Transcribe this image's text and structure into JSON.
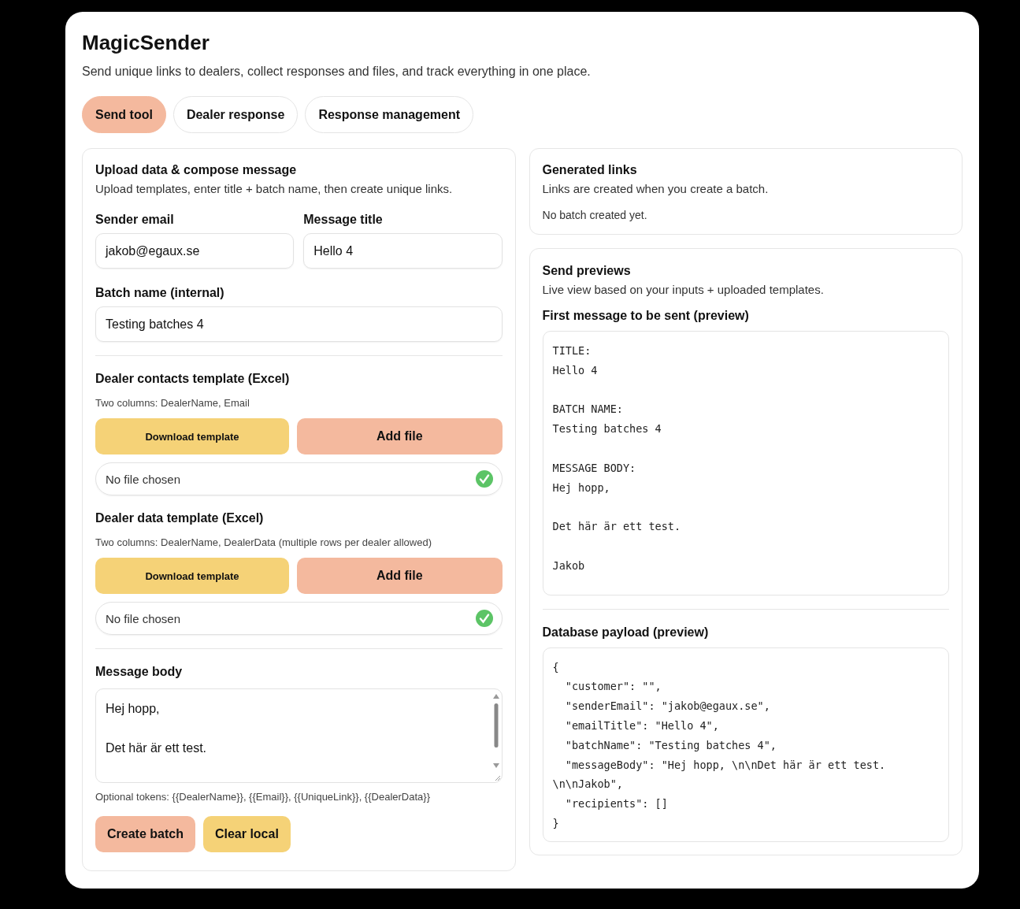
{
  "app": {
    "title": "MagicSender",
    "subtitle": "Send unique links to dealers, collect responses and files, and track everything in one place."
  },
  "tabs": [
    {
      "label": "Send tool",
      "selected": true
    },
    {
      "label": "Dealer response",
      "selected": false
    },
    {
      "label": "Response management",
      "selected": false
    }
  ],
  "compose": {
    "title": "Upload data & compose message",
    "subtitle": "Upload templates, enter title + batch name, then create unique links.",
    "sender_email": {
      "label": "Sender email",
      "value": "jakob@egaux.se"
    },
    "message_title": {
      "label": "Message title",
      "value": "Hello 4"
    },
    "batch_name": {
      "label": "Batch name (internal)",
      "value": "Testing batches 4"
    },
    "uploads": [
      {
        "title": "Dealer contacts template (Excel)",
        "hint": "Two columns: DealerName, Email",
        "download": "Download template",
        "add": "Add file",
        "file_status": "No file chosen"
      },
      {
        "title": "Dealer data template (Excel)",
        "hint": "Two columns: DealerName, DealerData (multiple rows per dealer allowed)",
        "download": "Download template",
        "add": "Add file",
        "file_status": "No file chosen"
      }
    ],
    "message_body": {
      "label": "Message body",
      "value": "Hej hopp,\n\nDet här är ett test."
    },
    "tokens": "Optional tokens: {{DealerName}}, {{Email}}, {{UniqueLink}}, {{DealerData}}",
    "buttons": [
      {
        "label": "Create batch",
        "kind": "primary"
      },
      {
        "label": "Clear local",
        "kind": "secondary"
      }
    ]
  },
  "generated_links": {
    "title": "Generated links",
    "subtitle": "Links are created when you create a batch.",
    "empty": "No batch created yet."
  },
  "previews": {
    "title": "Send previews",
    "subtitle": "Live view based on your inputs + uploaded templates.",
    "message_title": "First message to be sent (preview)",
    "message_blocks": [
      [
        "TITLE:",
        "Hello 4"
      ],
      [
        "BATCH NAME:",
        "Testing batches 4"
      ],
      [
        "MESSAGE BODY:",
        "Hej hopp,"
      ],
      [
        "Det här är ett test."
      ],
      [
        "Jakob"
      ]
    ],
    "payload_title": "Database payload (preview)",
    "payload_lines": [
      "{",
      "  \"customer\": \"\",",
      "  \"senderEmail\": \"jakob@egaux.se\",",
      "  \"emailTitle\": \"Hello 4\",",
      "  \"batchName\": \"Testing batches 4\",",
      "  \"messageBody\": \"Hej hopp, \\n\\nDet här är ett test.",
      "\\n\\nJakob\",",
      "  \"recipients\": []",
      "}"
    ]
  }
}
